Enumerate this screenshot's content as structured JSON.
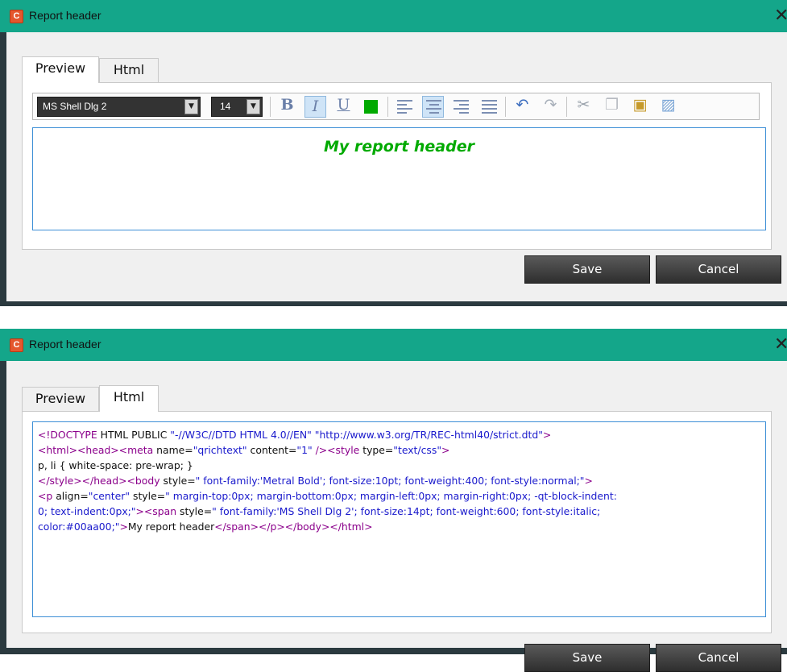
{
  "top_window": {
    "title": "Report header",
    "tabs": [
      {
        "label": "Preview"
      },
      {
        "label": "Html"
      }
    ],
    "active_tab": "Preview",
    "toolbar": {
      "font": "MS Shell Dlg 2",
      "size": "14",
      "bold_glyph": "B",
      "italic_glyph": "I",
      "underline_glyph": "U",
      "text_color": "#00aa00",
      "icons": [
        "bold-icon",
        "italic-icon",
        "underline-icon",
        "text-color-icon",
        "align-left-icon",
        "align-center-icon",
        "align-right-icon",
        "align-justify-icon",
        "undo-icon",
        "redo-icon",
        "cut-icon",
        "copy-icon",
        "paste-icon",
        "insert-image-icon"
      ]
    },
    "editor_text": "My report header",
    "buttons": {
      "save": "Save",
      "cancel": "Cancel"
    }
  },
  "bottom_window": {
    "title": "Report header",
    "tabs": [
      {
        "label": "Preview"
      },
      {
        "label": "Html"
      }
    ],
    "active_tab": "Html",
    "html_source": {
      "line1": {
        "a": "<!DOCTYPE",
        "b": " HTML PUBLIC ",
        "c": "\"-//W3C//DTD HTML 4.0//EN\"",
        "d": " ",
        "e": "\"http://www.w3.org/TR/REC-html40/strict.dtd\"",
        "f": ">"
      },
      "line2": {
        "a": "<html><head><meta",
        "b": " name=",
        "c": "\"qrichtext\"",
        "d": " content=",
        "e": "\"1\"",
        "f": " /><style",
        "g": " type=",
        "h": "\"text/css\"",
        "i": ">"
      },
      "line3": "p, li { white-space: pre-wrap; }",
      "line4": {
        "a": "</style></head><body",
        "b": " style=",
        "c": "\" font-family:'Metral Bold'; font-size:10pt; font-weight:400; font-style:normal;\"",
        "d": ">"
      },
      "line5": {
        "a": "<p",
        "b": " align=",
        "c": "\"center\"",
        "d": " style=",
        "e": "\" margin-top:0px; margin-bottom:0px; margin-left:0px; margin-right:0px; -qt-block-indent:"
      },
      "line6": {
        "a": "0; text-indent:0px;\"",
        "b": "><span",
        "c": " style=",
        "d": "\" font-family:'MS Shell Dlg 2'; font-size:14pt; font-weight:600; font-style:italic;"
      },
      "line7": {
        "a": "color:#00aa00;\"",
        "b": ">",
        "c": "My report header",
        "d": "</span></p></body></html>"
      }
    },
    "buttons": {
      "save": "Save",
      "cancel": "Cancel"
    }
  },
  "colors": {
    "titlebar": "#14a68a",
    "frame": "#2b3a3f",
    "editor_border": "#3d8fd6",
    "header_text": "#00aa00"
  }
}
